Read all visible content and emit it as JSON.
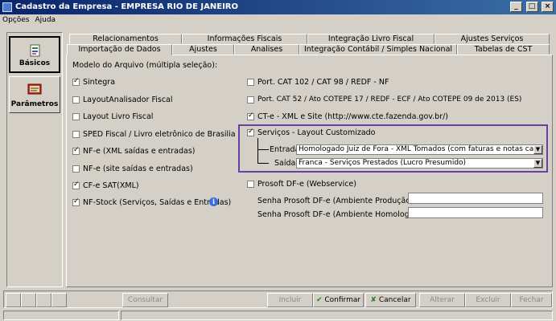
{
  "window": {
    "title": "Cadastro da Empresa - EMPRESA RIO DE JANEIRO",
    "minimize": "_",
    "maximize": "□",
    "close": "×"
  },
  "menu": [
    "Opções",
    "Ajuda"
  ],
  "left_nav": [
    {
      "label": "Básicos",
      "icon": "basic-data-icon",
      "active": true
    },
    {
      "label": "Parâmetros",
      "icon": "parameters-icon",
      "active": false
    }
  ],
  "tabs_row1": [
    "Relacionamentos",
    "Informações Fiscais",
    "Integração Livro Fiscal",
    "Ajustes Serviços"
  ],
  "tabs_row2": [
    "Importação de Dados",
    "Ajustes",
    "Analises",
    "Integração Contábil / Simples Nacional",
    "Tabelas de CST"
  ],
  "content": {
    "section_label": "Modelo do Arquivo (múltipla seleção):",
    "left_checks": [
      {
        "label": "Sintegra",
        "checked": true
      },
      {
        "label": "LayoutAnalisador Fiscal",
        "checked": false
      },
      {
        "label": "Layout Livro Fiscal",
        "checked": false
      },
      {
        "label": "SPED Fiscal / Livro eletrônico de Brasilia",
        "checked": false
      },
      {
        "label": "NF-e (XML saídas e entradas)",
        "checked": true
      },
      {
        "label": "NF-e (site saídas e entradas)",
        "checked": false
      },
      {
        "label": "CF-e SAT(XML)",
        "checked": true
      },
      {
        "label": "NF-Stock (Serviços, Saídas e Entradas)",
        "checked": true
      }
    ],
    "right_checks": [
      {
        "label": "Port. CAT 102 / CAT 98 / REDF - NF",
        "checked": false
      },
      {
        "label": "Port. CAT 52 / Ato COTEPE 17 / REDF - ECF / Ato COTEPE 09 de 2013 (ES)",
        "checked": false
      },
      {
        "label": "CT-e - XML e Site (http://www.cte.fazenda.gov.br/)",
        "checked": true
      }
    ],
    "servicos": {
      "label": "Serviços - Layout Customizado",
      "checked": true,
      "entrada_label": "Entrada:",
      "entrada_value": "Homologado Juiz de Fora - XML Tomados (com faturas e notas canceladas - ",
      "saida_label": "Saída:",
      "saida_value": "Franca - Serviços Prestados (Lucro Presumido)"
    },
    "prosoft": {
      "label": "Prosoft DF-e (Webservice)",
      "checked": false,
      "senha_prod_label": "Senha Prosoft DF-e (Ambiente Produção):",
      "senha_prod_value": "",
      "senha_hom_label": "Senha Prosoft DF-e (Ambiente Homologação):",
      "senha_hom_value": ""
    }
  },
  "check_mark": "✓",
  "dropdown_arrow": "▼",
  "info_glyph": "i",
  "buttons": {
    "consultar": "Consultar",
    "incluir": "Incluir",
    "confirmar": "Confirmar",
    "cancelar": "Cancelar",
    "alterar": "Alterar",
    "excluir": "Excluir",
    "fechar": "Fechar",
    "confirm_icon": "✔",
    "cancel_icon": "✘"
  },
  "colors": {
    "titlebar": "#0a246a",
    "face": "#d4d0c8",
    "group_highlight": "#6b3fa0"
  }
}
